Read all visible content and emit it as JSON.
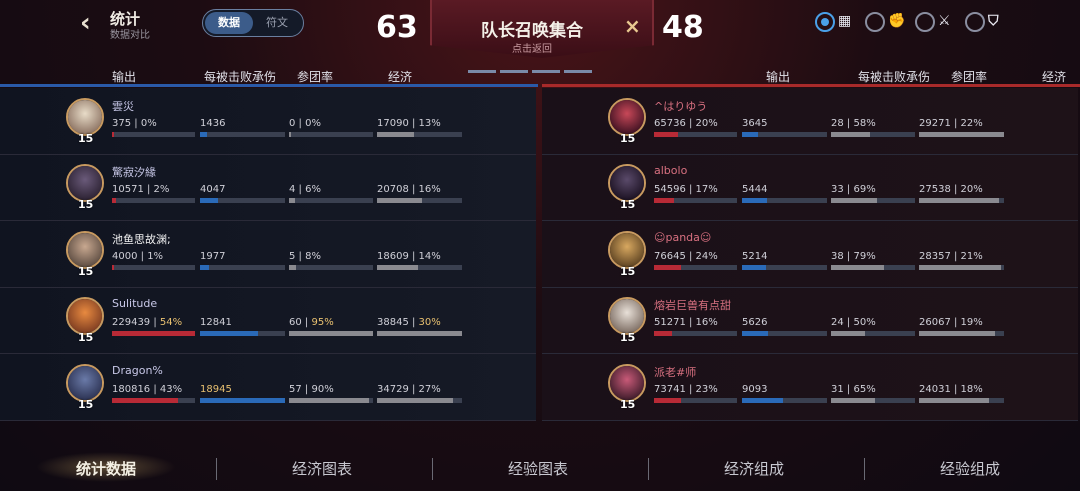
{
  "header": {
    "title": "统计",
    "subtitle": "数据对比",
    "toggle_on": "数据",
    "toggle_off": "符文",
    "score_blue": "63",
    "score_red": "48",
    "banner_title": "队长召唤集合",
    "banner_sub": "点击返回",
    "banner_x": "×"
  },
  "colors": {
    "blue": "#2a6ab8",
    "red": "#b82a36",
    "gray": "#8a8a90",
    "gold": "#e8c070"
  },
  "columns": [
    "输出",
    "每被击败承伤",
    "参团率",
    "经济"
  ],
  "blue_team": [
    {
      "name": "雲災",
      "level": "15",
      "name_color": "#c8c8e8",
      "dmg": "375",
      "dmg_pct": "0%",
      "dmg_frac": 0.0,
      "tank": "1436",
      "tank_frac": 0.08,
      "kp": "0",
      "kp_pct": "0%",
      "kp_frac": 0.0,
      "gold": "17090",
      "gold_pct": "13%",
      "gold_frac": 0.44,
      "hl": []
    },
    {
      "name": "驚寂汐緣",
      "level": "15",
      "name_color": "#c8c8e8",
      "dmg": "10571",
      "dmg_pct": "2%",
      "dmg_frac": 0.05,
      "tank": "4047",
      "tank_frac": 0.21,
      "kp": "4",
      "kp_pct": "6%",
      "kp_frac": 0.07,
      "gold": "20708",
      "gold_pct": "16%",
      "gold_frac": 0.53,
      "hl": []
    },
    {
      "name": "池鱼思故渊;",
      "level": "15",
      "name_color": "#f0f0f0",
      "dmg": "4000",
      "dmg_pct": "1%",
      "dmg_frac": 0.02,
      "tank": "1977",
      "tank_frac": 0.1,
      "kp": "5",
      "kp_pct": "8%",
      "kp_frac": 0.08,
      "gold": "18609",
      "gold_pct": "14%",
      "gold_frac": 0.48,
      "hl": []
    },
    {
      "name": "Sulitude",
      "level": "15",
      "name_color": "#c8c8e8",
      "dmg": "229439",
      "dmg_pct": "54%",
      "dmg_frac": 1.0,
      "tank": "12841",
      "tank_frac": 0.68,
      "kp": "60",
      "kp_pct": "95%",
      "kp_frac": 1.0,
      "gold": "38845",
      "gold_pct": "30%",
      "gold_frac": 1.0,
      "hl": [
        "dmg_pct",
        "kp_pct",
        "gold_pct"
      ]
    },
    {
      "name": "Dragon%",
      "level": "15",
      "name_color": "#c8c8e8",
      "dmg": "180816",
      "dmg_pct": "43%",
      "dmg_frac": 0.79,
      "tank": "18945",
      "tank_frac": 1.0,
      "kp": "57",
      "kp_pct": "90%",
      "kp_frac": 0.95,
      "gold": "34729",
      "gold_pct": "27%",
      "gold_frac": 0.89,
      "hl": [
        "tank"
      ]
    }
  ],
  "red_team": [
    {
      "name": "^はりゆう",
      "level": "15",
      "name_color": "#d87080",
      "dmg": "65736",
      "dmg_pct": "20%",
      "dmg_frac": 0.29,
      "tank": "3645",
      "tank_frac": 0.19,
      "kp": "28",
      "kp_pct": "58%",
      "kp_frac": 0.47,
      "gold": "29271",
      "gold_pct": "22%",
      "gold_frac": 1.0,
      "hl": []
    },
    {
      "name": "albolo",
      "level": "15",
      "name_color": "#d87080",
      "dmg": "54596",
      "dmg_pct": "17%",
      "dmg_frac": 0.24,
      "tank": "5444",
      "tank_frac": 0.29,
      "kp": "33",
      "kp_pct": "69%",
      "kp_frac": 0.55,
      "gold": "27538",
      "gold_pct": "20%",
      "gold_frac": 0.94,
      "hl": []
    },
    {
      "name": "☺panda☺",
      "level": "15",
      "name_color": "#d87080",
      "dmg": "76645",
      "dmg_pct": "24%",
      "dmg_frac": 0.33,
      "tank": "5214",
      "tank_frac": 0.28,
      "kp": "38",
      "kp_pct": "79%",
      "kp_frac": 0.63,
      "gold": "28357",
      "gold_pct": "21%",
      "gold_frac": 0.97,
      "hl": []
    },
    {
      "name": "熔岩巨兽有点甜",
      "level": "15",
      "name_color": "#d87080",
      "dmg": "51271",
      "dmg_pct": "16%",
      "dmg_frac": 0.22,
      "tank": "5626",
      "tank_frac": 0.3,
      "kp": "24",
      "kp_pct": "50%",
      "kp_frac": 0.4,
      "gold": "26067",
      "gold_pct": "19%",
      "gold_frac": 0.89,
      "hl": []
    },
    {
      "name": "派老#师",
      "level": "15",
      "name_color": "#d87080",
      "dmg": "73741",
      "dmg_pct": "23%",
      "dmg_frac": 0.32,
      "tank": "9093",
      "tank_frac": 0.48,
      "kp": "31",
      "kp_pct": "65%",
      "kp_frac": 0.52,
      "gold": "24031",
      "gold_pct": "18%",
      "gold_frac": 0.82,
      "hl": []
    }
  ],
  "tabs": [
    "统计数据",
    "经济图表",
    "经验图表",
    "经济组成",
    "经验组成"
  ],
  "modes": [
    {
      "icon": "grid-icon",
      "glyph": "▦",
      "selected": true
    },
    {
      "icon": "fist-icon",
      "glyph": "✊",
      "selected": false
    },
    {
      "icon": "swords-icon",
      "glyph": "⚔",
      "selected": false
    },
    {
      "icon": "shield-icon",
      "glyph": "⛉",
      "selected": false
    }
  ]
}
